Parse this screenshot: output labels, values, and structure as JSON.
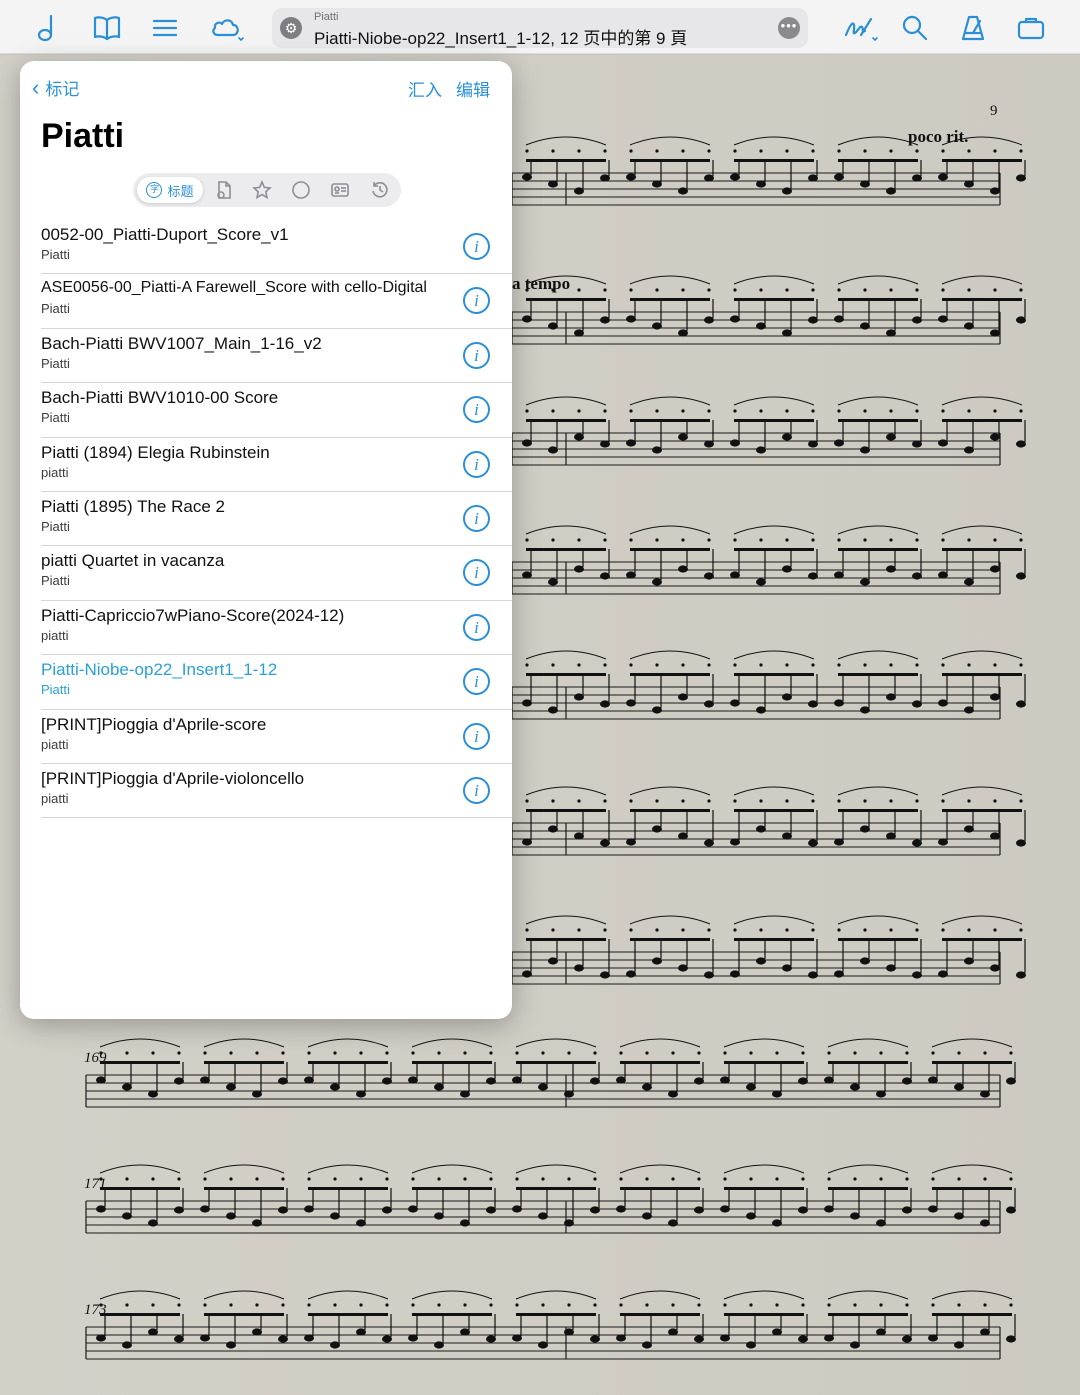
{
  "toolbar": {
    "document": {
      "composer": "Piatti",
      "title": "Piatti-Niobe-op22_Insert1_1-12, 12 页中的第 9 頁"
    },
    "icons_left": [
      "note-icon",
      "book-icon",
      "list-icon",
      "cloud-icon"
    ],
    "icons_right": [
      "annotate-icon",
      "search-icon",
      "metronome-icon",
      "toolbox-icon"
    ]
  },
  "score": {
    "page_number": "9",
    "tempo_mark_1": "poco rit.",
    "tempo_mark_2": "a tempo",
    "measure_numbers": [
      "169",
      "171",
      "173"
    ]
  },
  "popover": {
    "back_label": "标记",
    "import_label": "汇入",
    "edit_label": "编辑",
    "title": "Piatti",
    "segments": {
      "active_label": "标题",
      "active_badge": "字",
      "icons": [
        "file-icon",
        "star-icon",
        "circle-icon",
        "card-icon",
        "history-icon"
      ]
    },
    "items": [
      {
        "title": "0052-00_Piatti-Duport_Score_v1",
        "subtitle": "Piatti"
      },
      {
        "title": "ASE0056-00_Piatti-A Farewell_Score with cello-Digital",
        "subtitle": "Piatti"
      },
      {
        "title": "Bach-Piatti BWV1007_Main_1-16_v2",
        "subtitle": "Piatti"
      },
      {
        "title": "Bach-Piatti BWV1010-00 Score",
        "subtitle": "Piatti"
      },
      {
        "title": "Piatti (1894) Elegia Rubinstein",
        "subtitle": "piatti"
      },
      {
        "title": "Piatti (1895) The Race 2",
        "subtitle": "Piatti"
      },
      {
        "title": "piatti Quartet in vacanza",
        "subtitle": "Piatti"
      },
      {
        "title": "Piatti-Capriccio7wPiano-Score(2024-12)",
        "subtitle": "piatti"
      },
      {
        "title": "Piatti-Niobe-op22_Insert1_1-12",
        "subtitle": "Piatti"
      },
      {
        "title": "[PRINT]Pioggia d'Aprile-score",
        "subtitle": "piatti"
      },
      {
        "title": "[PRINT]Pioggia d'Aprile-violoncello",
        "subtitle": "piatti"
      }
    ]
  }
}
